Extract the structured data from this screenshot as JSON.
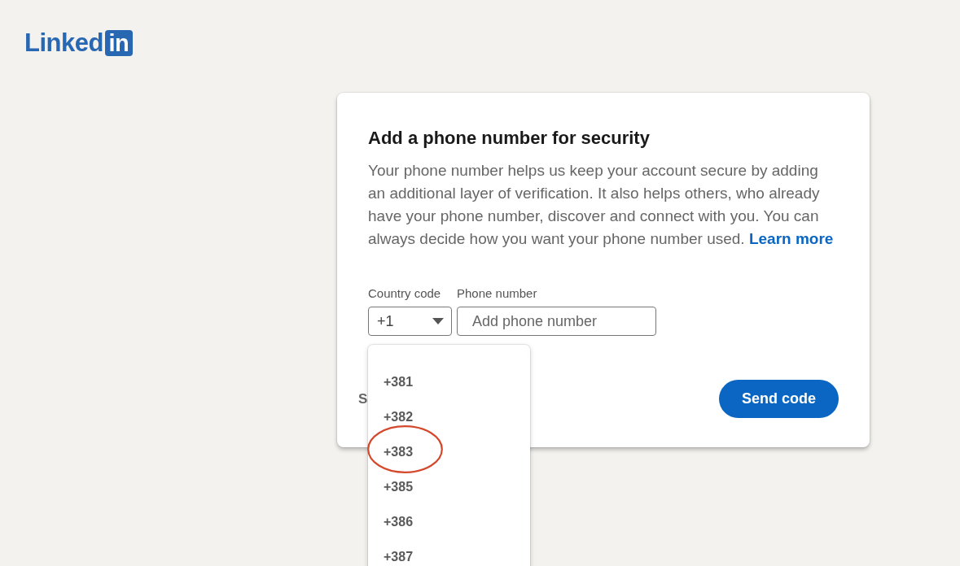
{
  "logo": {
    "wordmark": "Linked",
    "badge": "in"
  },
  "card": {
    "title": "Add a phone number for security",
    "description": "Your phone number helps us keep your account secure by adding an additional layer of verification. It also helps others, who already have your phone number, discover and connect with you. You can always decide how you want your phone number used.",
    "learn_more_link": "Learn more",
    "country_code": {
      "label": "Country code",
      "value": "+1",
      "expanded": true,
      "options": [
        {
          "label": "+381",
          "selected": false,
          "circled": false
        },
        {
          "label": "+382",
          "selected": false,
          "circled": false
        },
        {
          "label": "+383",
          "selected": false,
          "circled": true
        },
        {
          "label": "+385",
          "selected": false,
          "circled": false
        },
        {
          "label": "+386",
          "selected": false,
          "circled": false
        },
        {
          "label": "+387",
          "selected": false,
          "circled": false
        }
      ]
    },
    "phone_number": {
      "label": "Phone number",
      "placeholder": "Add phone number"
    },
    "partial_action": "S",
    "submit_button": "Send code"
  }
}
